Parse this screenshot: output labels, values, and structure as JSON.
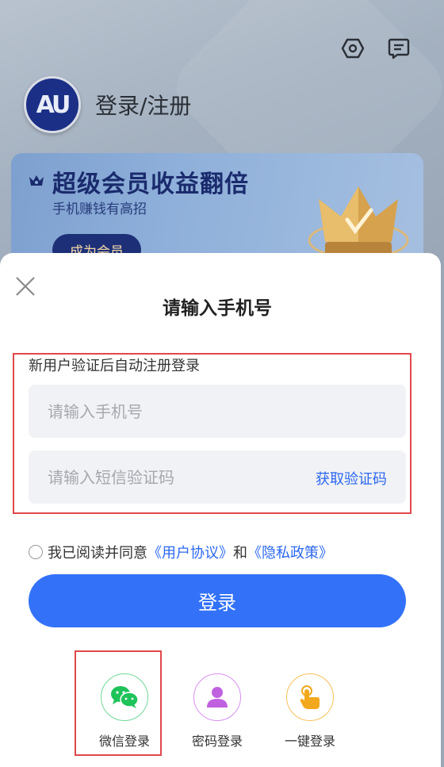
{
  "header": {
    "settings_icon": "settings-hexagon-icon",
    "message_icon": "message-icon",
    "avatar_text": "AU",
    "login_register": "登录/注册"
  },
  "vip_card": {
    "title": "超级会员收益翻倍",
    "subtitle": "手机赚钱有高招",
    "button": "成为会员"
  },
  "sheet": {
    "title": "请输入手机号",
    "hint": "新用户验证后自动注册登录",
    "phone_placeholder": "请输入手机号",
    "code_placeholder": "请输入短信验证码",
    "get_code": "获取验证码",
    "agree_prefix": "我已阅读并同意",
    "user_agreement": "《用户协议》",
    "and": "和",
    "privacy_policy": "《隐私政策》",
    "login_button": "登录",
    "alt_logins": [
      {
        "label": "微信登录",
        "icon": "wechat-icon",
        "color": "#1fc35a"
      },
      {
        "label": "密码登录",
        "icon": "user-icon",
        "color": "#c061e0"
      },
      {
        "label": "一键登录",
        "icon": "tap-icon",
        "color": "#f2a81d"
      }
    ]
  },
  "colors": {
    "accent": "#3372f8",
    "link": "#2c68f0",
    "highlight": "#e0484b"
  }
}
